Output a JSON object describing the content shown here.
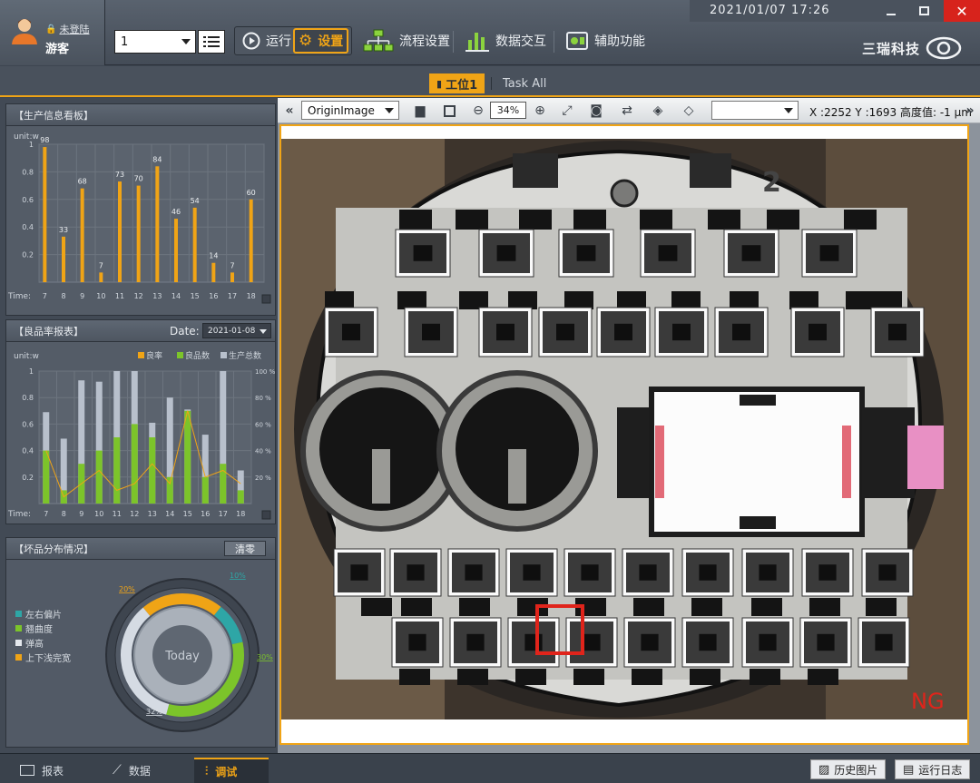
{
  "user": {
    "login_link": "未登陆",
    "name": "游客"
  },
  "header": {
    "datetime": "2021/01/07  17:26",
    "station_select": "1",
    "run_label": "运行",
    "settings_label": "设置",
    "flow_label": "流程设置",
    "data_label": "数据交互",
    "aux_label": "辅助功能",
    "brand": "三瑞科技"
  },
  "tabs": [
    {
      "label": "工位1",
      "active": true
    },
    {
      "label": "Task All",
      "active": false
    }
  ],
  "production": {
    "title": "【生产信息看板】",
    "unit": "unit:w",
    "time_label": "Time:"
  },
  "yield": {
    "title": "【良品率报表】",
    "date_label": "Date:",
    "date_value": "2021-01-08",
    "unit": "unit:w",
    "legend": [
      "良率",
      "良品数",
      "生产总数"
    ],
    "time_label": "Time:"
  },
  "defect": {
    "title": "【坏品分布情况】",
    "clear_label": "清零",
    "legend": [
      "左右偏片",
      "翘曲度",
      "弹高",
      "上下浅完宽"
    ],
    "center": "Today",
    "labels": [
      "20%",
      "10%",
      "30%",
      "32%"
    ]
  },
  "viewer": {
    "image_select": "OriginImage",
    "zoom": "34%",
    "coords": "X :2252 Y :1693 高度值: -1 μm",
    "status": "NG",
    "part_number": "2"
  },
  "bottom": {
    "report": "报表",
    "data": "数据",
    "debug": "调试",
    "history": "历史图片",
    "log": "运行日志"
  },
  "colors": {
    "accent": "#f0a416",
    "green": "#7cc42a",
    "teal": "#2ea6a6",
    "grey_bar": "#b8c0cc",
    "ng": "#e0241b"
  },
  "chart_data": [
    {
      "type": "bar",
      "title": "【生产信息看板】",
      "xlabel": "Time:",
      "ylabel": "unit:w",
      "categories": [
        "7",
        "8",
        "9",
        "10",
        "11",
        "12",
        "13",
        "14",
        "15",
        "16",
        "17",
        "18"
      ],
      "values": [
        98,
        33,
        68,
        7,
        73,
        70,
        84,
        46,
        54,
        14,
        7,
        60
      ],
      "yticks": [
        "0.2",
        "0.4",
        "0.6",
        "0.8",
        "1"
      ],
      "ylim": [
        0,
        100
      ],
      "grid": true
    },
    {
      "type": "bar",
      "title": "【良品率报表】",
      "xlabel": "Time:",
      "ylabel": "unit:w",
      "categories": [
        "7",
        "8",
        "9",
        "10",
        "11",
        "12",
        "13",
        "14",
        "15",
        "16",
        "17",
        "18"
      ],
      "series": [
        {
          "name": "生产总数",
          "values": [
            0.69,
            0.49,
            0.93,
            0.92,
            1.0,
            1.0,
            0.61,
            0.8,
            0.71,
            0.52,
            1.0,
            0.25
          ]
        },
        {
          "name": "良品数",
          "values": [
            0.4,
            0.1,
            0.3,
            0.4,
            0.5,
            0.6,
            0.5,
            0.2,
            0.7,
            0.2,
            0.3,
            0.1
          ]
        },
        {
          "name": "良率",
          "values": [
            0.4,
            0.05,
            0.15,
            0.25,
            0.1,
            0.15,
            0.3,
            0.15,
            0.7,
            0.2,
            0.25,
            0.15
          ]
        }
      ],
      "yticks": [
        "0.2",
        "0.4",
        "0.6",
        "0.8",
        "1"
      ],
      "y2ticks": [
        "20 %",
        "40 %",
        "60 %",
        "80 %",
        "100 %"
      ],
      "ylim": [
        0,
        1
      ],
      "grid": true
    },
    {
      "type": "pie",
      "title": "【坏品分布情况】",
      "categories": [
        "上下浅完宽",
        "左右偏片",
        "翘曲度",
        "弹高"
      ],
      "values": [
        20,
        10,
        30,
        32
      ],
      "colors": [
        "#f0a416",
        "#2ea6a6",
        "#7cc42a",
        "#d5dbe3"
      ]
    }
  ]
}
